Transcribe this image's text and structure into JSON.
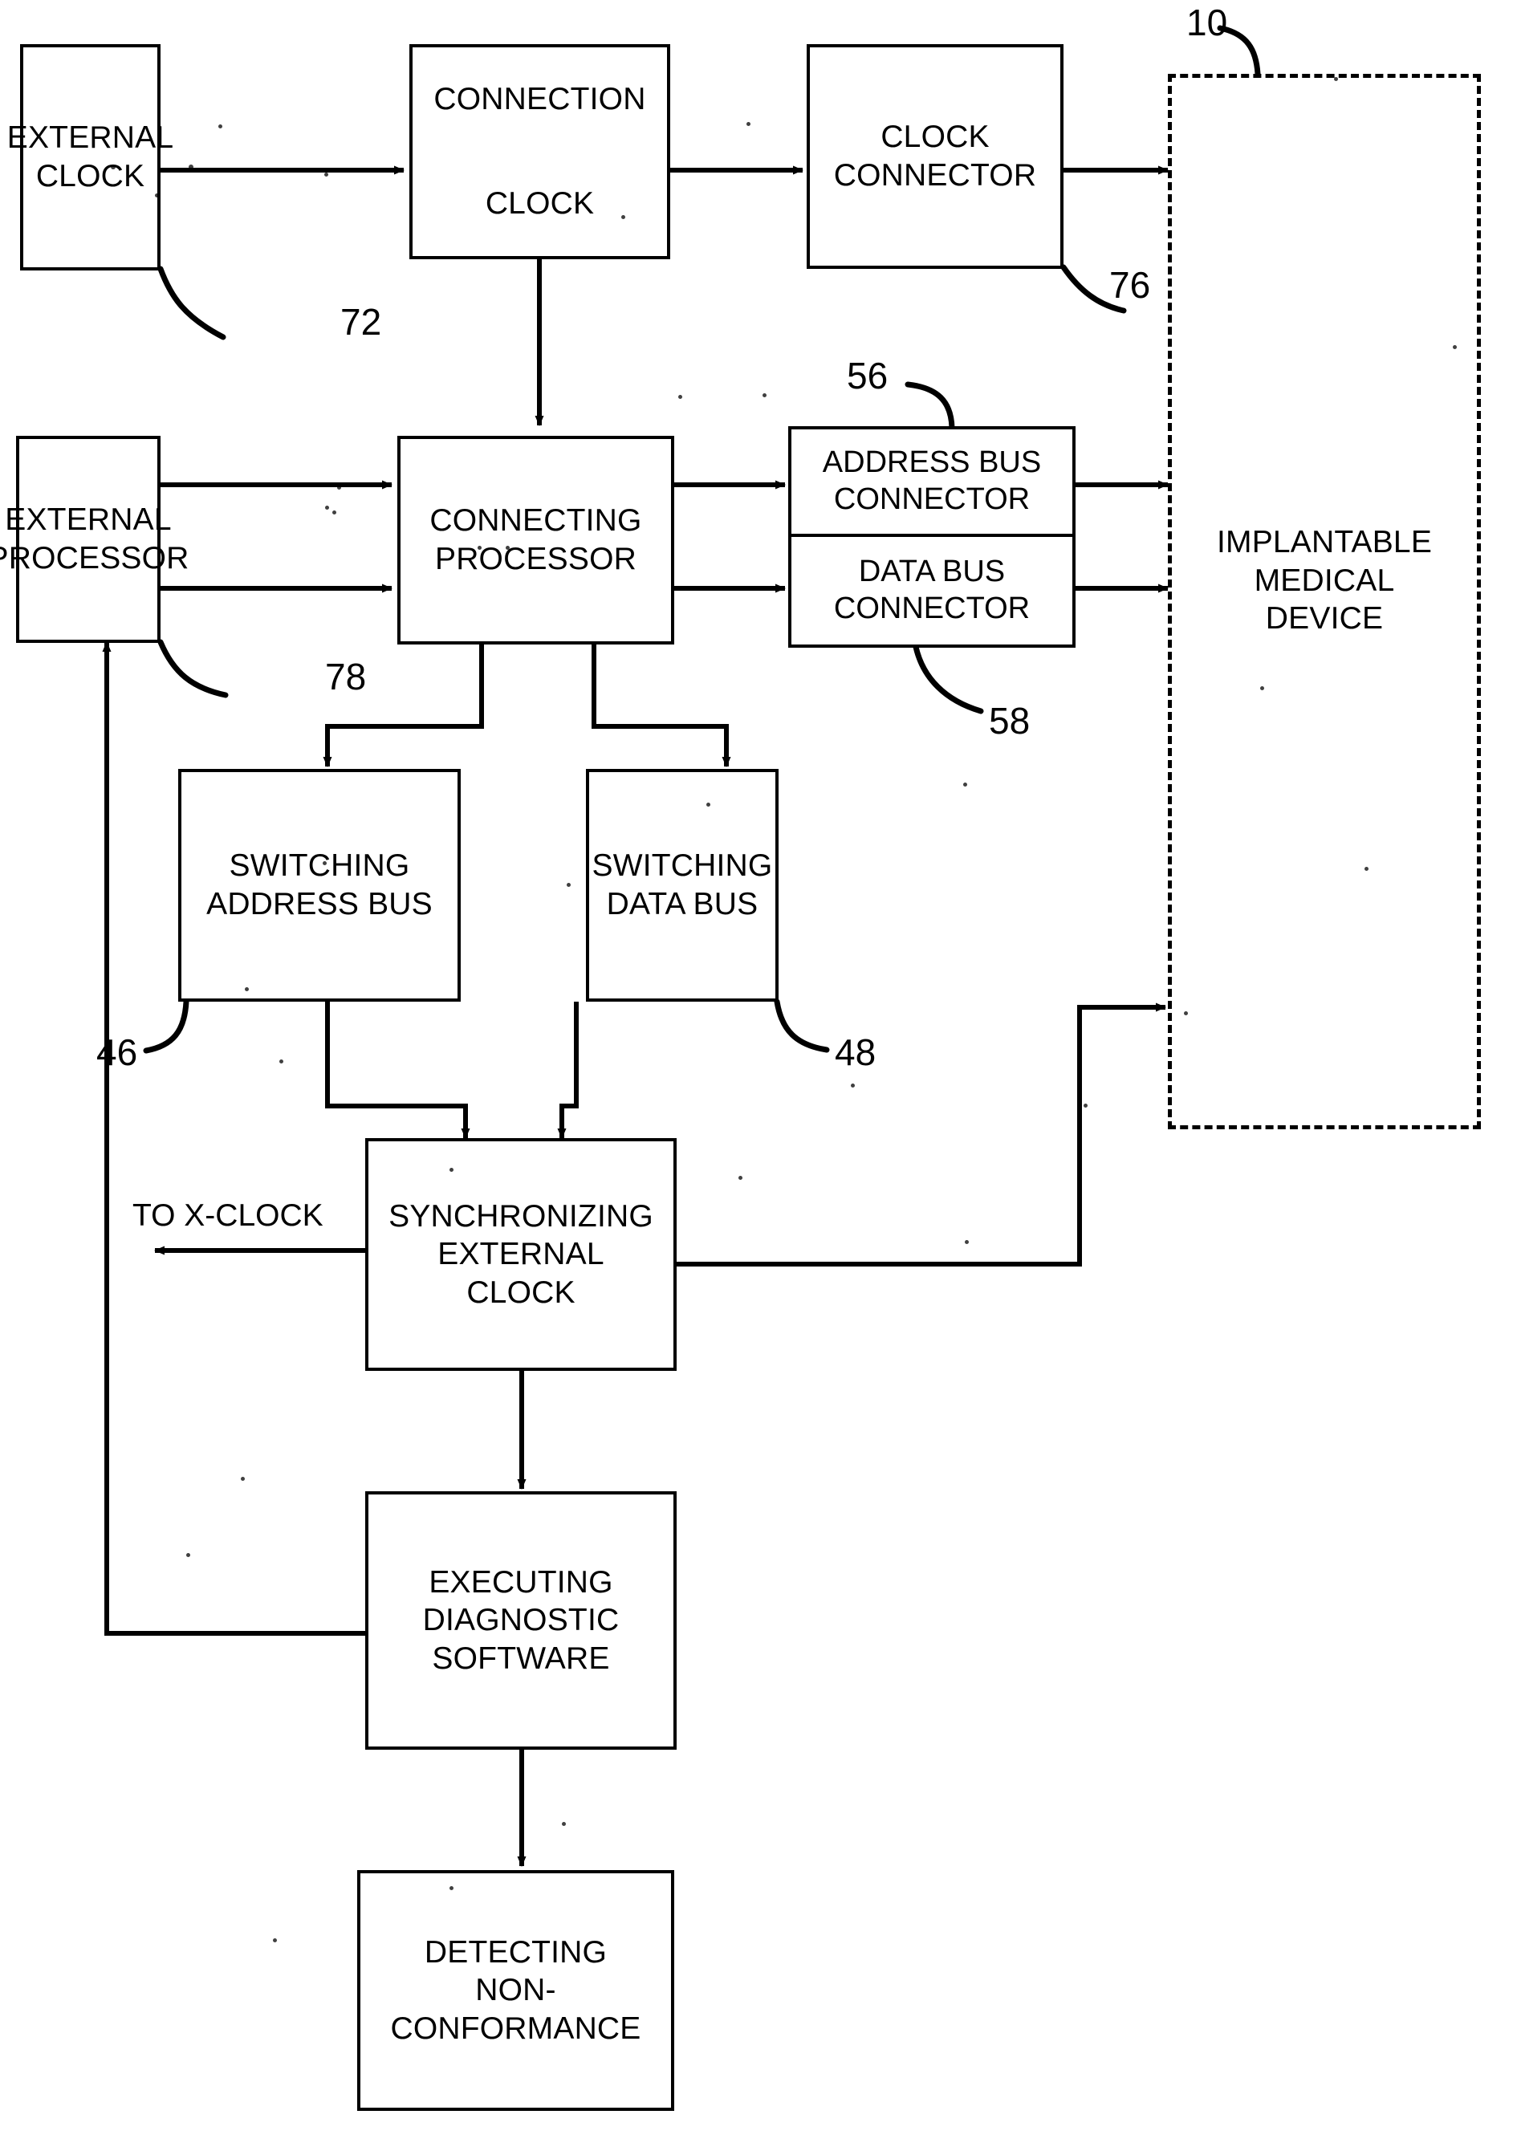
{
  "figure": {
    "type": "patent-block-diagram",
    "title_text": "",
    "background": "#ffffff",
    "line_color": "#000000"
  },
  "blocks": [
    {
      "id": "external-clock",
      "lines": [
        "EXTERNAL",
        "CLOCK"
      ],
      "style": "solid"
    },
    {
      "id": "connection-clock",
      "lines": [
        "CONNECTION",
        "CLOCK"
      ],
      "style": "solid"
    },
    {
      "id": "clock-connector",
      "lines": [
        "CLOCK",
        "CONNECTOR"
      ],
      "style": "solid"
    },
    {
      "id": "implantable-medical-device",
      "lines": [
        "IMPLANTABLE",
        "MEDICAL",
        "DEVICE"
      ],
      "style": "dashed"
    },
    {
      "id": "external-processor",
      "lines": [
        "EXTERNAL",
        "PROCESSOR"
      ],
      "style": "solid"
    },
    {
      "id": "connecting-processor",
      "lines": [
        "CONNECTING",
        "PROCESSOR"
      ],
      "style": "solid"
    },
    {
      "id": "address-bus-connector",
      "lines": [
        "ADDRESS BUS",
        "CONNECTOR"
      ],
      "style": "solid"
    },
    {
      "id": "data-bus-connector",
      "lines": [
        "DATA BUS",
        "CONNECTOR"
      ],
      "style": "solid"
    },
    {
      "id": "switching-address-bus",
      "lines": [
        "SWITCHING",
        "ADDRESS BUS"
      ],
      "style": "solid"
    },
    {
      "id": "switching-data-bus",
      "lines": [
        "SWITCHING",
        "DATA BUS"
      ],
      "style": "solid"
    },
    {
      "id": "synchronizing-external-clock",
      "lines": [
        "SYNCHRONIZING",
        "EXTERNAL",
        "CLOCK"
      ],
      "style": "solid"
    },
    {
      "id": "executing-diagnostic-software",
      "lines": [
        "EXECUTING",
        "DIAGNOSTIC",
        "SOFTWARE"
      ],
      "style": "solid"
    },
    {
      "id": "detecting-non-conformance",
      "lines": [
        "DETECTING",
        "NON-",
        "CONFORMANCE"
      ],
      "style": "solid"
    }
  ],
  "labels": {
    "to_x_clock": "TO X-CLOCK"
  },
  "reference_numerals": [
    {
      "id": "ref-10",
      "value": "10",
      "points_to": "implantable-medical-device"
    },
    {
      "id": "ref-72",
      "value": "72",
      "points_to": "external-clock"
    },
    {
      "id": "ref-76",
      "value": "76",
      "points_to": "clock-connector"
    },
    {
      "id": "ref-56",
      "value": "56",
      "points_to": "address-bus-connector"
    },
    {
      "id": "ref-58",
      "value": "58",
      "points_to": "data-bus-connector"
    },
    {
      "id": "ref-78",
      "value": "78",
      "points_to": "external-processor"
    },
    {
      "id": "ref-46",
      "value": "46",
      "points_to": "switching-address-bus"
    },
    {
      "id": "ref-48",
      "value": "48",
      "points_to": "switching-data-bus"
    }
  ],
  "connections": [
    {
      "from": "external-clock",
      "to": "connection-clock",
      "kind": "arrow"
    },
    {
      "from": "connection-clock",
      "to": "clock-connector",
      "kind": "arrow"
    },
    {
      "from": "clock-connector",
      "to": "implantable-medical-device",
      "kind": "arrow"
    },
    {
      "from": "connection-clock",
      "to": "connecting-processor",
      "kind": "arrow"
    },
    {
      "from": "external-processor",
      "to": "connecting-processor",
      "kind": "arrow"
    },
    {
      "from": "external-processor",
      "to": "connecting-processor",
      "kind": "arrow"
    },
    {
      "from": "connecting-processor",
      "to": "address-bus-connector",
      "kind": "arrow"
    },
    {
      "from": "connecting-processor",
      "to": "data-bus-connector",
      "kind": "arrow"
    },
    {
      "from": "address-bus-connector",
      "to": "implantable-medical-device",
      "kind": "arrow"
    },
    {
      "from": "data-bus-connector",
      "to": "implantable-medical-device",
      "kind": "arrow"
    },
    {
      "from": "connecting-processor",
      "to": "switching-address-bus",
      "kind": "arrow"
    },
    {
      "from": "connecting-processor",
      "to": "switching-data-bus",
      "kind": "arrow"
    },
    {
      "from": "switching-address-bus",
      "to": "synchronizing-external-clock",
      "kind": "arrow"
    },
    {
      "from": "switching-data-bus",
      "to": "synchronizing-external-clock",
      "kind": "arrow"
    },
    {
      "from": "synchronizing-external-clock",
      "to": "to-x-clock",
      "kind": "arrow"
    },
    {
      "from": "synchronizing-external-clock",
      "to": "implantable-medical-device",
      "kind": "arrow"
    },
    {
      "from": "synchronizing-external-clock",
      "to": "executing-diagnostic-software",
      "kind": "arrow"
    },
    {
      "from": "executing-diagnostic-software",
      "to": "external-processor",
      "kind": "arrow"
    },
    {
      "from": "executing-diagnostic-software",
      "to": "detecting-non-conformance",
      "kind": "arrow"
    }
  ]
}
